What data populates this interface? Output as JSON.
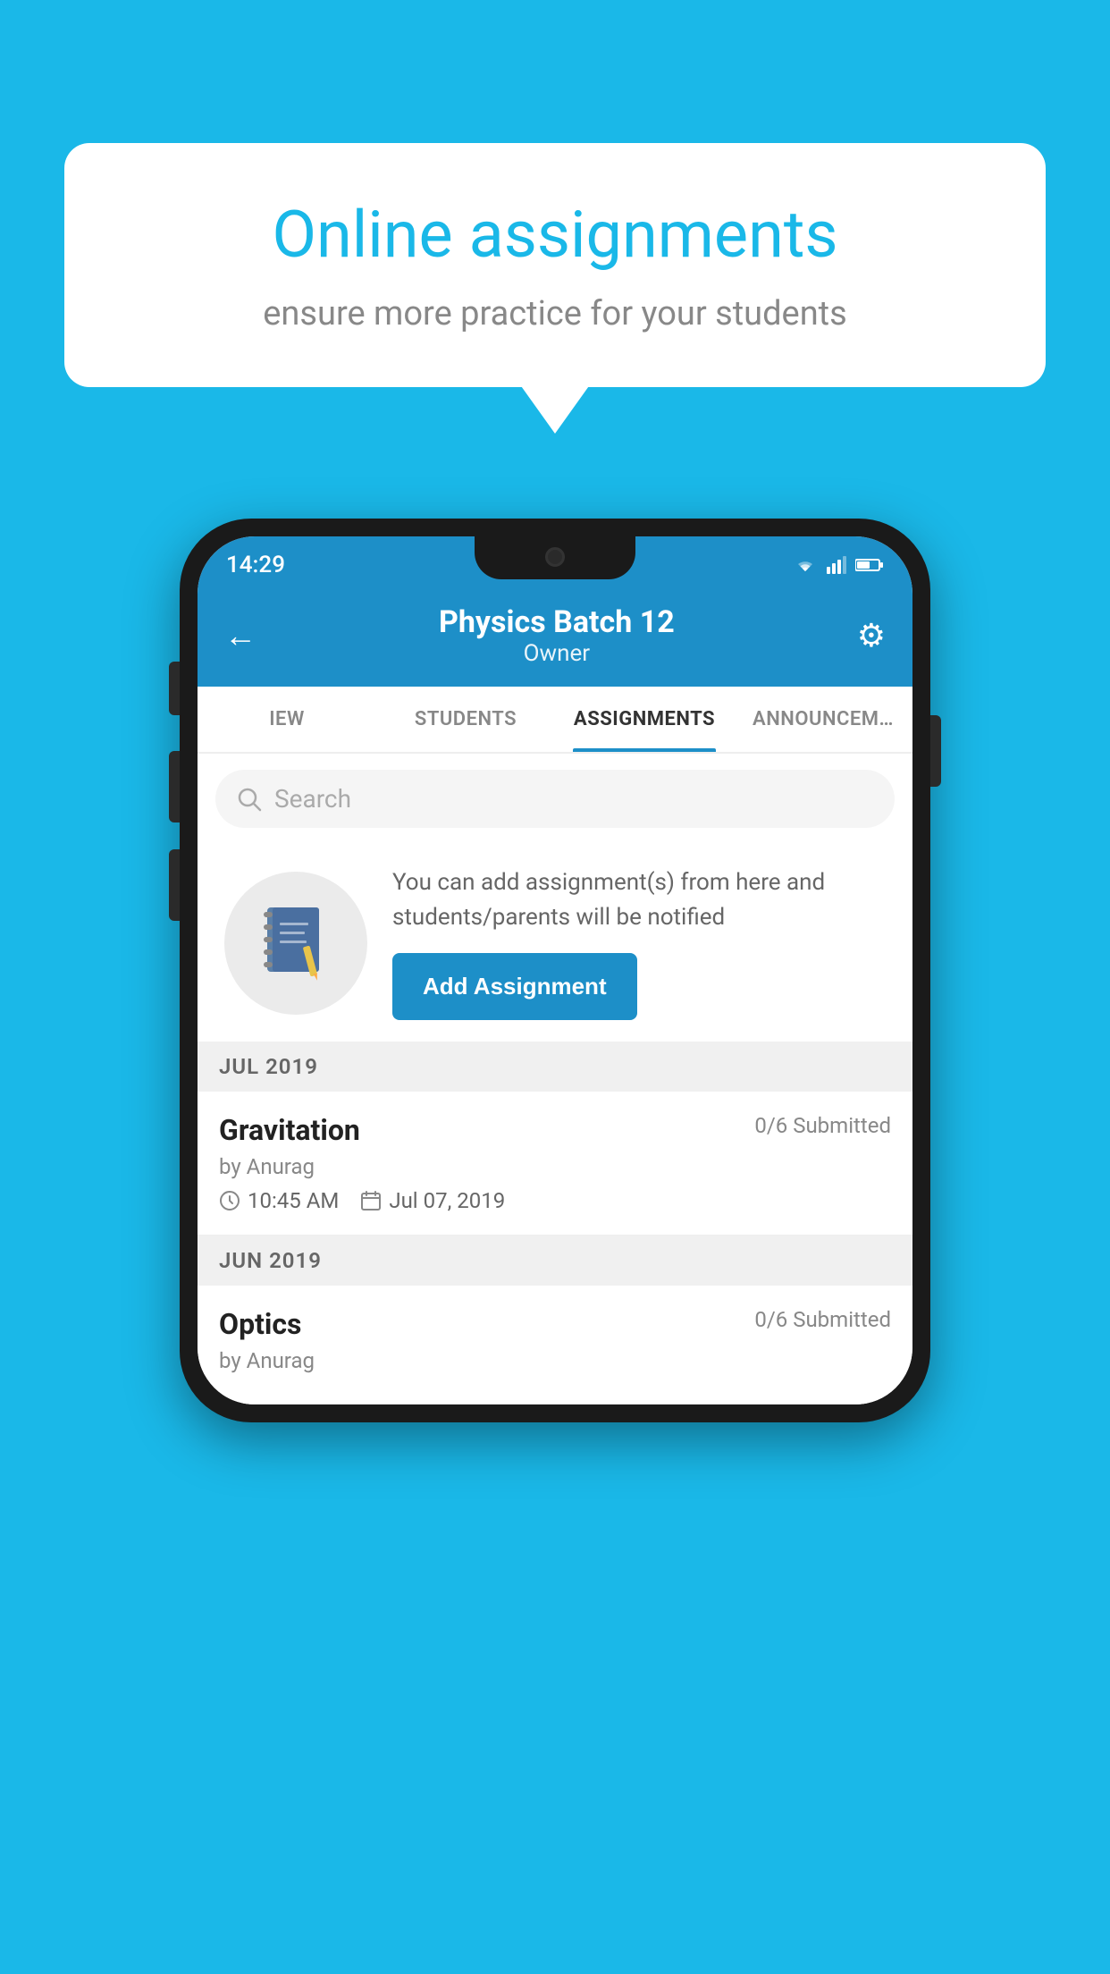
{
  "background_color": "#1ab8e8",
  "speech_bubble": {
    "title": "Online assignments",
    "subtitle": "ensure more practice for your students"
  },
  "phone": {
    "status_bar": {
      "time": "14:29"
    },
    "header": {
      "title": "Physics Batch 12",
      "subtitle": "Owner",
      "back_label": "←",
      "settings_label": "⚙"
    },
    "tabs": [
      {
        "label": "IEW",
        "active": false
      },
      {
        "label": "STUDENTS",
        "active": false
      },
      {
        "label": "ASSIGNMENTS",
        "active": true
      },
      {
        "label": "ANNOUNCEM…",
        "active": false
      }
    ],
    "search": {
      "placeholder": "Search"
    },
    "add_assignment": {
      "description": "You can add assignment(s) from here and students/parents will be notified",
      "button_label": "Add Assignment"
    },
    "sections": [
      {
        "month_label": "JUL 2019",
        "assignments": [
          {
            "name": "Gravitation",
            "submitted": "0/6 Submitted",
            "by": "by Anurag",
            "time": "10:45 AM",
            "date": "Jul 07, 2019"
          }
        ]
      },
      {
        "month_label": "JUN 2019",
        "assignments": [
          {
            "name": "Optics",
            "submitted": "0/6 Submitted",
            "by": "by Anurag",
            "time": "",
            "date": ""
          }
        ]
      }
    ]
  }
}
